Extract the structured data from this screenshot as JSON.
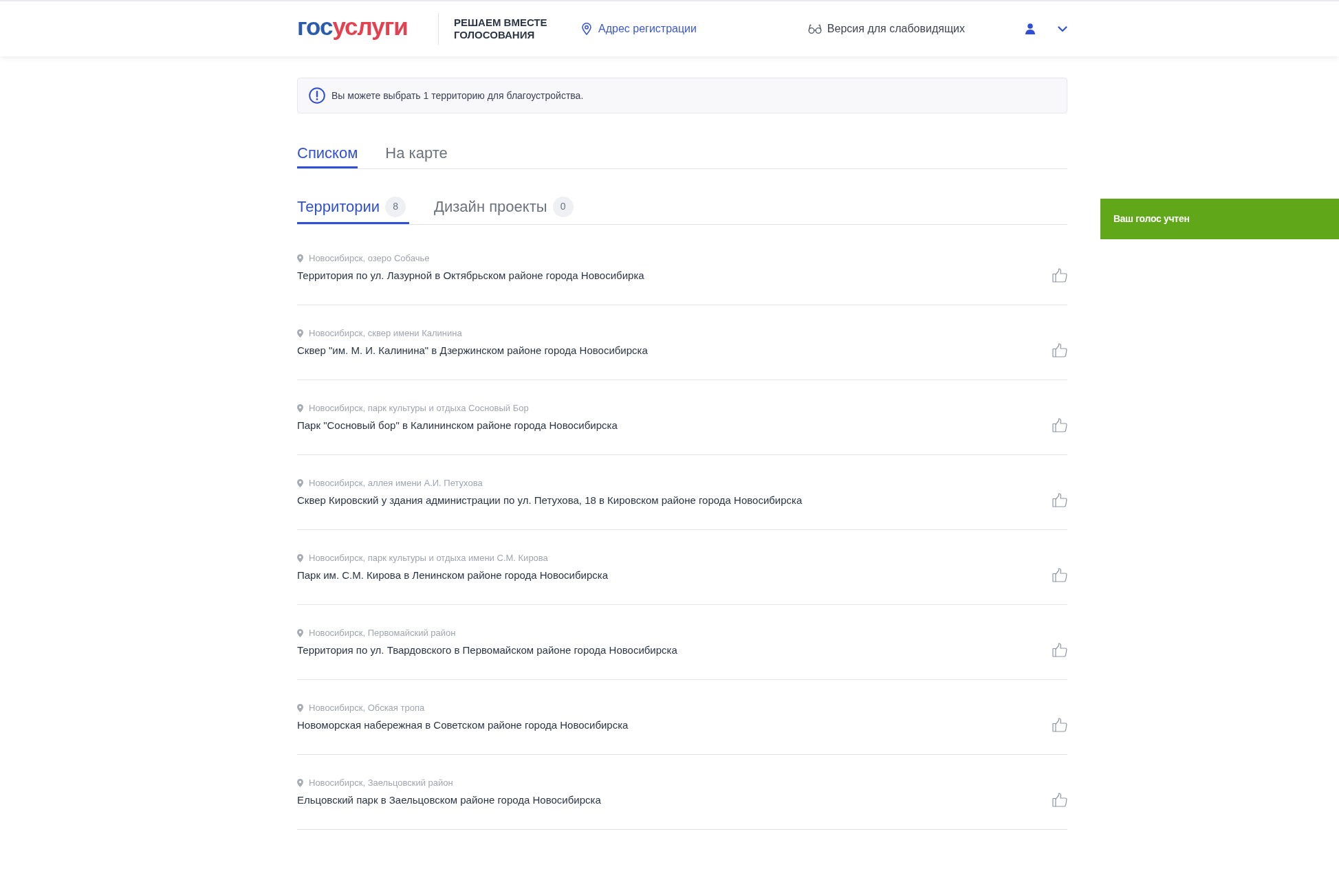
{
  "header": {
    "logo": [
      "гос",
      "услуги"
    ],
    "service_title_lines": [
      "РЕШАЕМ ВМЕСТЕ",
      "ГОЛОСОВАНИЯ"
    ],
    "address_link": "Адрес регистрации",
    "accessibility_link": "Версия для слабовидящих"
  },
  "notice": "Вы можете выбрать 1 территорию для благоустройства.",
  "view_tabs": [
    {
      "label": "Списком",
      "selected": true
    },
    {
      "label": "На карте",
      "selected": false
    }
  ],
  "category_tabs": [
    {
      "label": "Территории",
      "count": "8",
      "selected": true
    },
    {
      "label": "Дизайн проекты",
      "count": "0",
      "selected": false
    }
  ],
  "territories": [
    {
      "location": "Новосибирск, озеро Собачье",
      "title": "Территория по ул. Лазурной в Октябрьском районе города Новосибирка"
    },
    {
      "location": "Новосибирск, сквер имени Калинина",
      "title": "Сквер \"им. М. И. Калинина\" в Дзержинском районе города Новосибирска"
    },
    {
      "location": "Новосибирск, парк культуры и отдыха Сосновый Бор",
      "title": "Парк \"Сосновый бор\" в Калининском районе города Новосибирска"
    },
    {
      "location": "Новосибирск, аллея имени А.И. Петухова",
      "title": "Сквер Кировский у здания администрации по ул. Петухова, 18 в Кировском районе города Новосибирска"
    },
    {
      "location": "Новосибирск, парк культуры и отдыха имени С.М. Кирова",
      "title": "Парк им. С.М. Кирова в Ленинском районе города Новосибирска"
    },
    {
      "location": "Новосибирск, Первомайский район",
      "title": "Территория по ул. Твардовского в Первомайском районе города Новосибирска"
    },
    {
      "location": "Новосибирск, Обская тропа",
      "title": "Новоморская набережная в Советском районе города Новосибирска"
    },
    {
      "location": "Новосибирск, Заельцовский район",
      "title": "Ельцовский парк в Заельцовском районе города Новосибирска"
    }
  ],
  "toast": "Ваш голос учтен"
}
